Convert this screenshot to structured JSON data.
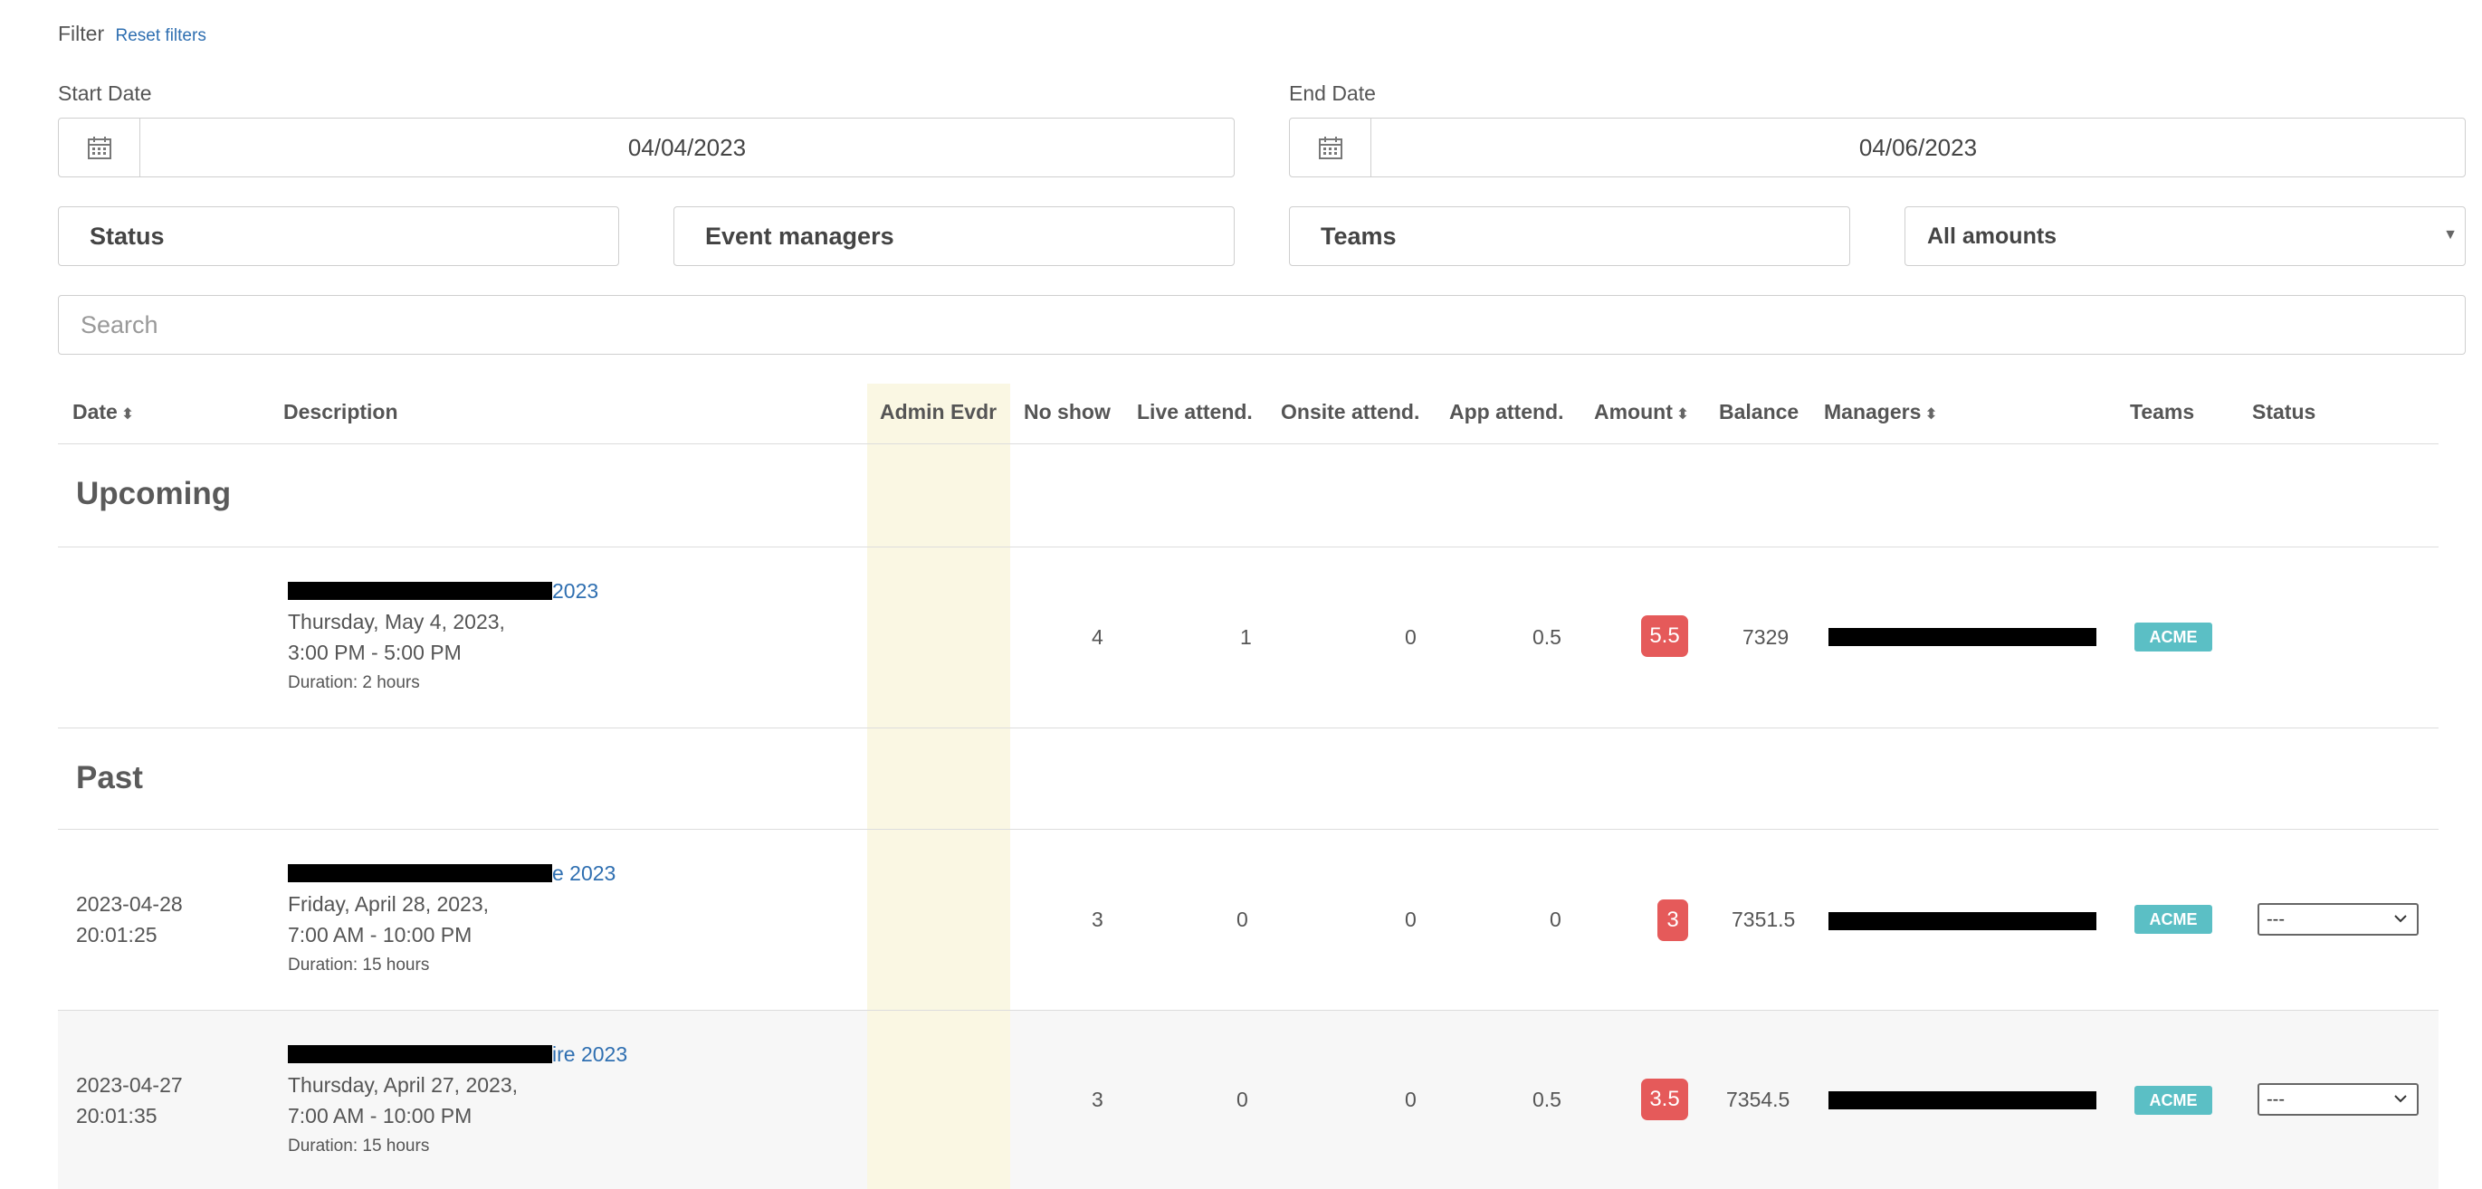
{
  "filter": {
    "label": "Filter",
    "reset_label": "Reset filters",
    "start_date_label": "Start Date",
    "start_date_value": "04/04/2023",
    "end_date_label": "End Date",
    "end_date_value": "04/06/2023",
    "status_placeholder": "Status",
    "event_managers_placeholder": "Event managers",
    "teams_placeholder": "Teams",
    "amount_select_value": "All amounts",
    "search_placeholder": "Search"
  },
  "table": {
    "headers": {
      "date": "Date",
      "description": "Description",
      "admin_evdr": "Admin Evdr",
      "no_show": "No show",
      "live_attend": "Live attend.",
      "onsite_attend": "Onsite attend.",
      "app_attend": "App attend.",
      "amount": "Amount",
      "balance": "Balance",
      "managers": "Managers",
      "teams": "Teams",
      "status": "Status"
    },
    "sections": {
      "upcoming": "Upcoming",
      "past": "Past"
    },
    "upcoming_rows": [
      {
        "date_line1": "",
        "date_line2": "",
        "title_suffix": "2023",
        "date_text": "Thursday, May 4, 2023,",
        "time_text": "3:00 PM - 5:00 PM",
        "duration": "Duration: 2 hours",
        "no_show": "4",
        "live": "1",
        "onsite": "0",
        "app": "0.5",
        "amount": "5.5",
        "balance": "7329",
        "team": "ACME"
      }
    ],
    "past_rows": [
      {
        "date_line1": "2023-04-28",
        "date_line2": "20:01:25",
        "title_suffix": "e 2023",
        "date_text": "Friday, April 28, 2023,",
        "time_text": "7:00 AM - 10:00 PM",
        "duration": "Duration: 15 hours",
        "no_show": "3",
        "live": "0",
        "onsite": "0",
        "app": "0",
        "amount": "3",
        "balance": "7351.5",
        "team": "ACME",
        "status": "---"
      },
      {
        "date_line1": "2023-04-27",
        "date_line2": "20:01:35",
        "title_suffix": "ire 2023",
        "date_text": "Thursday, April 27, 2023,",
        "time_text": "7:00 AM - 10:00 PM",
        "duration": "Duration: 15 hours",
        "no_show": "3",
        "live": "0",
        "onsite": "0",
        "app": "0.5",
        "amount": "3.5",
        "balance": "7354.5",
        "team": "ACME",
        "status": "---"
      }
    ]
  },
  "colors": {
    "link": "#2f6fb1",
    "amount_badge": "#e55a5a",
    "team_badge": "#5bbfc5",
    "admin_column": "#faf7e3"
  }
}
